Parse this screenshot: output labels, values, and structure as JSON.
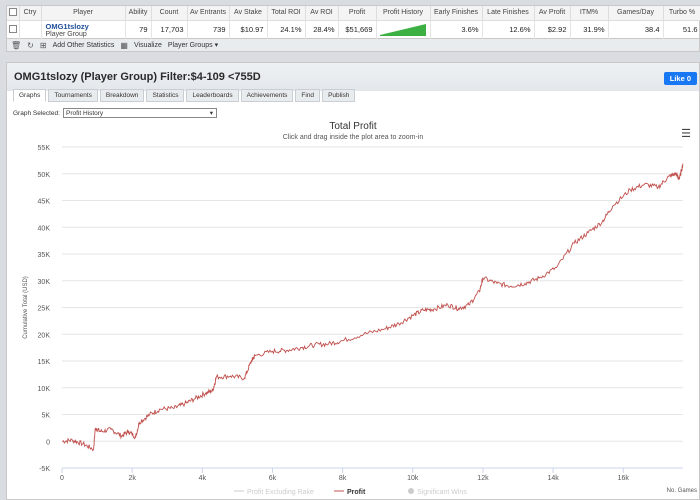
{
  "stats": {
    "headers": [
      "Ctry",
      "Player",
      "Ability",
      "Count",
      "Av Entrants",
      "Av Stake",
      "Total ROI",
      "Av ROI",
      "Profit",
      "Profit History",
      "Early Finishes",
      "Late Finishes",
      "Av Profit",
      "ITM%",
      "Games/Day",
      "Turbo %"
    ],
    "row": {
      "player": "OMG1tslozy",
      "player_sub": "Player Group",
      "ability": "79",
      "count": "17,703",
      "av_entrants": "739",
      "av_stake": "$10.97",
      "total_roi": "24.1%",
      "av_roi": "28.4%",
      "profit": "$51,669",
      "early_finishes": "3.6%",
      "late_finishes": "12.6%",
      "av_profit": "$2.92",
      "itm": "31.9%",
      "games_day": "38.4",
      "turbo": "51.6"
    },
    "colors": {
      "spark_fill": "#3cb043"
    }
  },
  "toolbar": {
    "add_stats": "Add Other Statistics",
    "visualize": "Visualize",
    "player_groups": "Player Groups"
  },
  "panel": {
    "title": "OMG1tslozy (Player Group) Filter:$4-109 <755D",
    "like": "Like 0",
    "tabs": [
      "Graphs",
      "Tournaments",
      "Breakdown",
      "Statistics",
      "Leaderboards",
      "Achievements",
      "Find",
      "Publish"
    ],
    "graph_selected_label": "Graph Selected:",
    "graph_selected_value": "Profit History"
  },
  "chart_data": {
    "type": "line",
    "title": "Total Profit",
    "subtitle": "Click and drag inside the plot area to zoom-in",
    "ylabel": "Cumulative Total (USD)",
    "xlabel": "No. Games",
    "ylim": [
      -5000,
      55000
    ],
    "xlim": [
      0,
      17703
    ],
    "y_ticks": [
      "-5K",
      "0",
      "5K",
      "10K",
      "15K",
      "20K",
      "25K",
      "30K",
      "35K",
      "40K",
      "45K",
      "50K",
      "55K"
    ],
    "x_ticks": [
      "0",
      "2k",
      "4k",
      "6k",
      "8k",
      "10k",
      "12k",
      "14k",
      "16k"
    ],
    "legend": [
      "Profit Excluding Rake",
      "Profit",
      "Significant Wins"
    ],
    "legend_placement": "bottom",
    "series": [
      {
        "name": "Profit",
        "color": "#c0504d",
        "x": [
          0,
          300,
          600,
          900,
          950,
          1100,
          1400,
          1700,
          1900,
          2100,
          2200,
          2500,
          2800,
          3200,
          3500,
          3800,
          4100,
          4300,
          4400,
          4800,
          5200,
          5400,
          5500,
          6000,
          6400,
          6800,
          7200,
          7600,
          8000,
          8600,
          9200,
          9600,
          10000,
          10300,
          10600,
          11000,
          11300,
          11600,
          11900,
          12000,
          12400,
          12800,
          13200,
          13600,
          14100,
          14600,
          15000,
          15400,
          15700,
          16200,
          16600,
          17000,
          17300,
          17500,
          17600,
          17703
        ],
        "y": [
          0,
          200,
          -500,
          -1500,
          2500,
          1800,
          2200,
          1000,
          1800,
          800,
          3500,
          5000,
          6000,
          6200,
          7000,
          8000,
          9000,
          9500,
          12000,
          12200,
          11800,
          15000,
          16000,
          16800,
          17000,
          17500,
          18000,
          18200,
          18800,
          20000,
          21000,
          22000,
          23500,
          24500,
          24700,
          25500,
          24800,
          25500,
          28000,
          30500,
          29500,
          29000,
          29500,
          30500,
          32500,
          37000,
          39000,
          41000,
          44000,
          47000,
          48000,
          47500,
          49500,
          50000,
          49000,
          51900
        ]
      }
    ]
  }
}
